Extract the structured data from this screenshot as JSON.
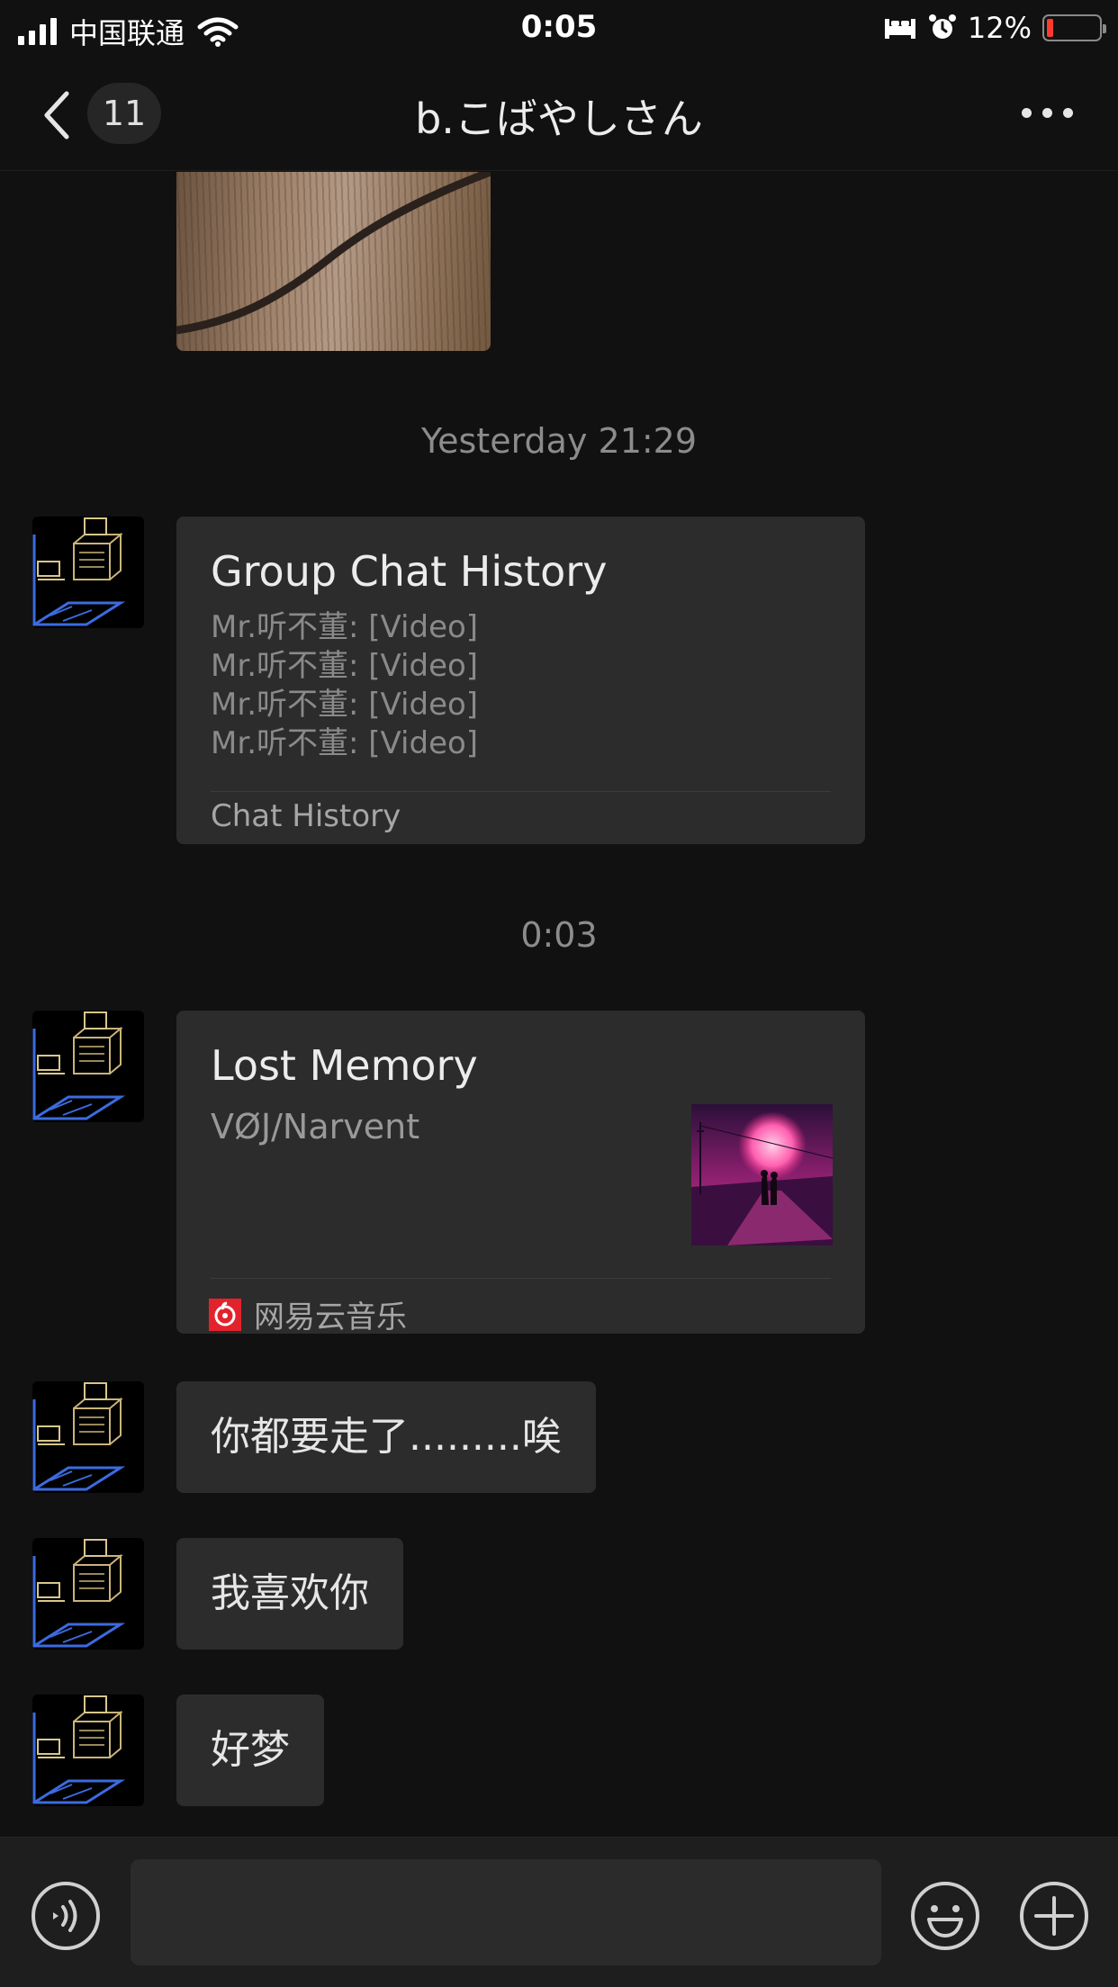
{
  "status_bar": {
    "carrier": "中国联通",
    "time": "0:05",
    "battery_percent": "12%",
    "battery_level": 0.12,
    "icons": [
      "signal-icon",
      "wifi-icon",
      "sleep-icon",
      "alarm-icon",
      "battery-icon"
    ]
  },
  "nav": {
    "back_count": "11",
    "title": "b.こばやしさん",
    "icons": [
      "chevron-left-icon",
      "more-icon"
    ]
  },
  "messages": {
    "timestamp_1": "Yesterday 21:29",
    "chat_history": {
      "title": "Group Chat History",
      "lines": [
        "Mr.听不董: [Video]",
        "Mr.听不董: [Video]",
        "Mr.听不董: [Video]",
        "Mr.听不董: [Video]"
      ],
      "footer": "Chat History"
    },
    "timestamp_2": "0:03",
    "music": {
      "title": "Lost Memory",
      "artist": "VØJ/Narvent",
      "app_name": "网易云音乐"
    },
    "texts": [
      "你都要走了.........唉",
      "我喜欢你",
      "好梦"
    ]
  },
  "input_bar": {
    "placeholder": "",
    "icons": [
      "voice-icon",
      "emoji-icon",
      "plus-icon"
    ]
  },
  "colors": {
    "background": "#111111",
    "bubble": "#2c2c2c",
    "netease_red": "#e3232c",
    "battery_low": "#ff3b30"
  }
}
